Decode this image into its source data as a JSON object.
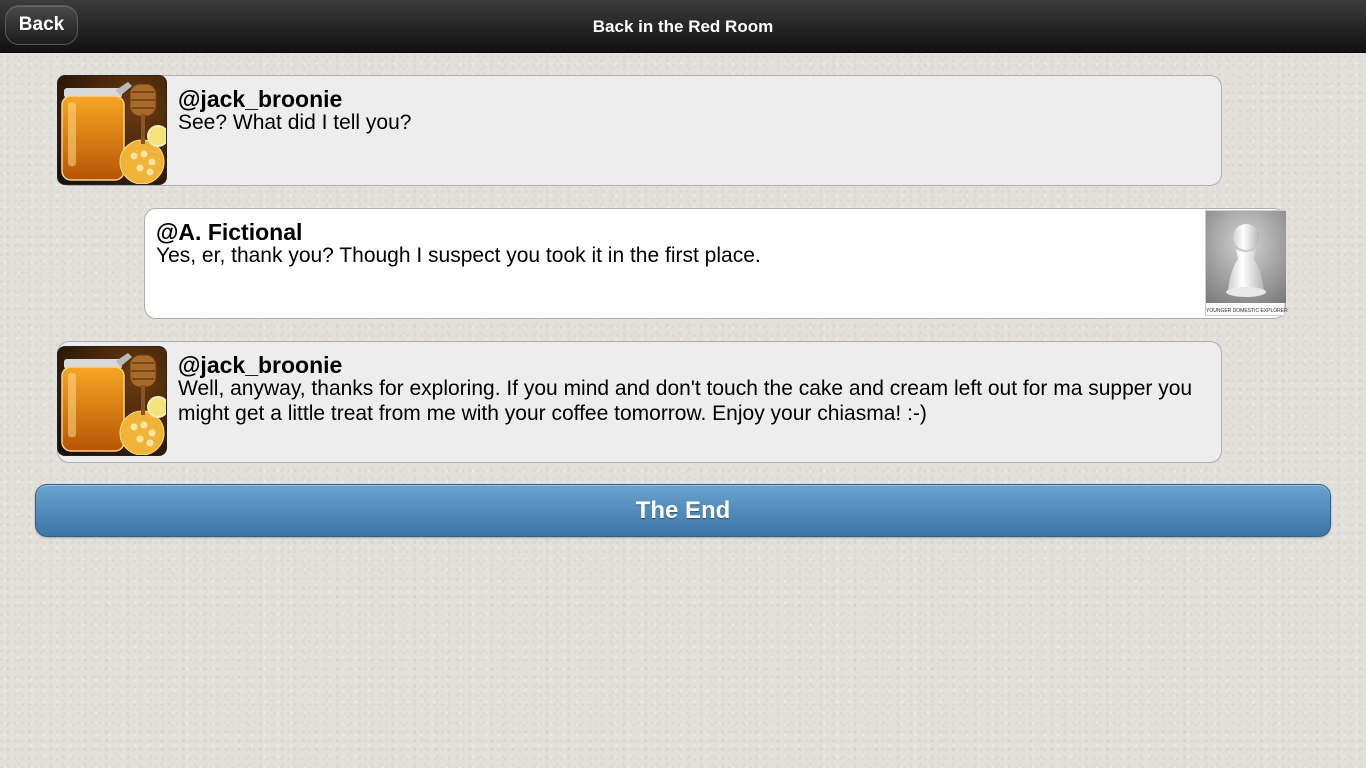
{
  "header": {
    "back_label": "Back",
    "title": "Back in the Red Room"
  },
  "messages": [
    {
      "author": "@jack_broonie",
      "text": "See? What did I tell you?",
      "side": "left",
      "avatar": "honey-jar-avatar"
    },
    {
      "author": "@A. Fictional",
      "text": "Yes, er, thank you? Though I suspect you took it in the first place.",
      "side": "right",
      "avatar": "pawn-avatar",
      "avatar_caption": "YOUNGER DOMESTIC EXPLORER"
    },
    {
      "author": "@jack_broonie",
      "text": "Well, anyway, thanks for exploring. If you mind and don't touch the cake and cream left out for ma supper you might get a little treat from me with your coffee tomorrow. Enjoy your chiasma! :-)",
      "side": "left",
      "avatar": "honey-jar-avatar"
    }
  ],
  "end_button": {
    "label": "The End"
  },
  "colors": {
    "header": "#1c1c1c",
    "end_button": "#4a85b8",
    "background": "#e3e0db"
  }
}
